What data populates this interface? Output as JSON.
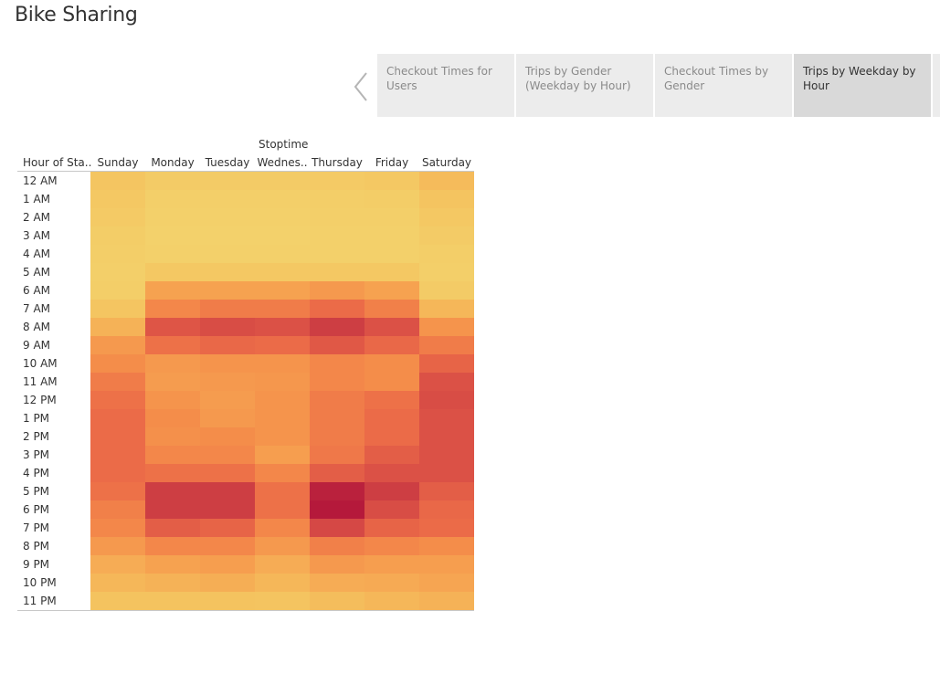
{
  "header": {
    "title": "Bike Sharing"
  },
  "tabs": [
    {
      "label": "Checkout Times for Users",
      "active": false
    },
    {
      "label": "Trips by Gender (Weekday by Hour)",
      "active": false
    },
    {
      "label": "Checkout Times by Gender",
      "active": false
    },
    {
      "label": "Trips by Weekday by Hour",
      "active": true
    }
  ],
  "icons": {
    "prev": "chevron-left-icon"
  },
  "chart_data": {
    "type": "heatmap",
    "title": "",
    "column_field": "Stoptime",
    "row_field": "Hour of Sta..",
    "columns": [
      "Sunday",
      "Monday",
      "Tuesday",
      "Wednes..",
      "Thursday",
      "Friday",
      "Saturday"
    ],
    "rows": [
      "12 AM",
      "1 AM",
      "2 AM",
      "3 AM",
      "4 AM",
      "5 AM",
      "6 AM",
      "7 AM",
      "8 AM",
      "9 AM",
      "10 AM",
      "11 AM",
      "12 PM",
      "1 PM",
      "2 PM",
      "3 PM",
      "4 PM",
      "5 PM",
      "6 PM",
      "7 PM",
      "8 PM",
      "9 PM",
      "10 PM",
      "11 PM"
    ],
    "color_scale": [
      "#f3d26c",
      "#f4c35f",
      "#f6a451",
      "#f48b4a",
      "#ec6d48",
      "#dc5246",
      "#cc3d43",
      "#b5193b"
    ],
    "values": [
      [
        0.12,
        0.07,
        0.07,
        0.07,
        0.08,
        0.1,
        0.18
      ],
      [
        0.1,
        0.03,
        0.03,
        0.03,
        0.04,
        0.05,
        0.13
      ],
      [
        0.08,
        0.02,
        0.02,
        0.02,
        0.03,
        0.03,
        0.1
      ],
      [
        0.05,
        0.01,
        0.01,
        0.01,
        0.02,
        0.02,
        0.07
      ],
      [
        0.04,
        0.02,
        0.02,
        0.02,
        0.02,
        0.02,
        0.04
      ],
      [
        0.03,
        0.1,
        0.1,
        0.1,
        0.1,
        0.1,
        0.03
      ],
      [
        0.04,
        0.3,
        0.3,
        0.3,
        0.35,
        0.3,
        0.07
      ],
      [
        0.12,
        0.45,
        0.5,
        0.5,
        0.58,
        0.48,
        0.2
      ],
      [
        0.22,
        0.7,
        0.75,
        0.72,
        0.85,
        0.72,
        0.38
      ],
      [
        0.35,
        0.55,
        0.6,
        0.58,
        0.68,
        0.6,
        0.5
      ],
      [
        0.42,
        0.35,
        0.38,
        0.38,
        0.45,
        0.42,
        0.62
      ],
      [
        0.5,
        0.33,
        0.35,
        0.36,
        0.45,
        0.42,
        0.72
      ],
      [
        0.55,
        0.38,
        0.33,
        0.38,
        0.5,
        0.55,
        0.75
      ],
      [
        0.58,
        0.42,
        0.35,
        0.38,
        0.5,
        0.58,
        0.72
      ],
      [
        0.58,
        0.4,
        0.42,
        0.38,
        0.5,
        0.58,
        0.72
      ],
      [
        0.58,
        0.45,
        0.45,
        0.32,
        0.52,
        0.65,
        0.72
      ],
      [
        0.58,
        0.55,
        0.55,
        0.45,
        0.65,
        0.72,
        0.72
      ],
      [
        0.55,
        0.85,
        0.85,
        0.55,
        0.97,
        0.85,
        0.65
      ],
      [
        0.48,
        0.85,
        0.85,
        0.55,
        1.0,
        0.75,
        0.6
      ],
      [
        0.45,
        0.65,
        0.62,
        0.45,
        0.78,
        0.62,
        0.58
      ],
      [
        0.35,
        0.45,
        0.45,
        0.35,
        0.48,
        0.45,
        0.42
      ],
      [
        0.25,
        0.3,
        0.32,
        0.25,
        0.35,
        0.32,
        0.32
      ],
      [
        0.2,
        0.22,
        0.24,
        0.2,
        0.25,
        0.26,
        0.28
      ],
      [
        0.14,
        0.14,
        0.14,
        0.13,
        0.17,
        0.2,
        0.22
      ]
    ]
  }
}
